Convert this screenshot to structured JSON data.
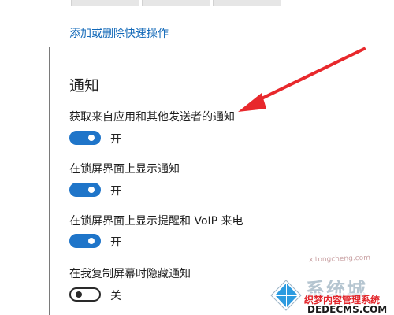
{
  "quick_actions": {
    "tiles": [
      "",
      "",
      ""
    ],
    "add_remove_link": "添加或删除快速操作"
  },
  "notifications": {
    "title": "通知",
    "settings": [
      {
        "label": "获取来自应用和其他发送者的通知",
        "state": "开",
        "on": true
      },
      {
        "label": "在锁屏界面上显示通知",
        "state": "开",
        "on": true
      },
      {
        "label": "在锁屏界面上显示提醒和 VoIP 来电",
        "state": "开",
        "on": true
      },
      {
        "label": "在我复制屏幕时隐藏通知",
        "state": "关",
        "on": false
      }
    ]
  },
  "annotation": {
    "arrow_color": "#e8282c"
  },
  "watermark": {
    "top_text": "xitongcheng.com",
    "brand": "系统城",
    "site": "织梦内容管理系统",
    "domain": "DEDECMS.COM"
  },
  "colors": {
    "accent": "#1f75c9",
    "link": "#1168b8"
  }
}
